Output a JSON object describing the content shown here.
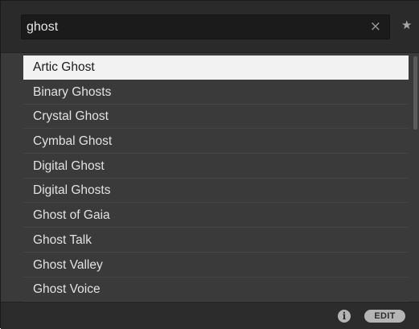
{
  "search": {
    "value": "ghost",
    "clear_icon": "×",
    "favorite_icon": "★"
  },
  "results": {
    "items": [
      {
        "label": "Artic Ghost",
        "selected": true
      },
      {
        "label": "Binary Ghosts",
        "selected": false
      },
      {
        "label": "Crystal Ghost",
        "selected": false
      },
      {
        "label": "Cymbal Ghost",
        "selected": false
      },
      {
        "label": "Digital Ghost",
        "selected": false
      },
      {
        "label": "Digital Ghosts",
        "selected": false
      },
      {
        "label": "Ghost of Gaia",
        "selected": false
      },
      {
        "label": "Ghost Talk",
        "selected": false
      },
      {
        "label": "Ghost Valley",
        "selected": false
      },
      {
        "label": "Ghost Voice",
        "selected": false
      }
    ]
  },
  "footer": {
    "info_icon": "i",
    "edit_label": "EDIT"
  },
  "colors": {
    "panel_bg": "#2c2c2c",
    "list_bg": "#3a3a3a",
    "selected_bg": "#f2f2f2",
    "text": "#e2e2e2"
  }
}
